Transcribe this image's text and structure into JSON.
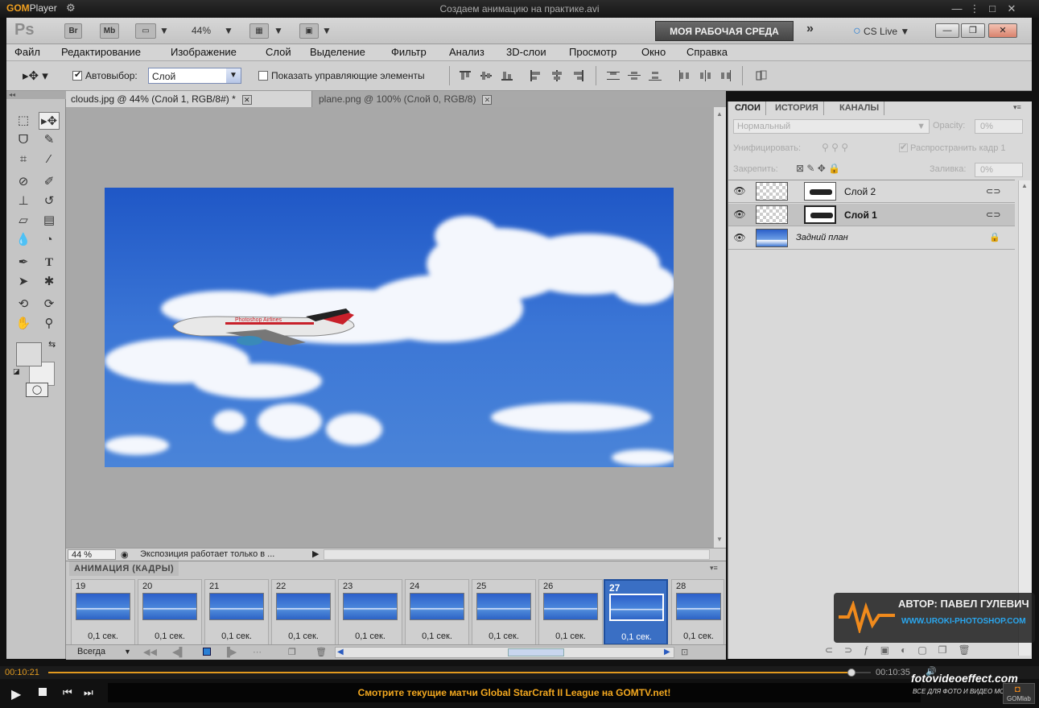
{
  "player": {
    "logo_gom": "GOM",
    "logo_player": "Player",
    "file_title": "Создаем анимацию на практике.avi",
    "time_current": "00:10:21",
    "time_total": "00:10:35",
    "seek_progress": 0.977,
    "ad_text": "Смотрите текущие матчи Global StarCraft II League на GOMTV.net!",
    "gomlab_label": "GOMlab"
  },
  "ps": {
    "logo": "Ps",
    "bridge_label": "Br",
    "minibridge_label": "Mb",
    "zoom_value": "44%",
    "workspace_button": "МОЯ РАБОЧАЯ СРЕДА",
    "cs_live": "CS Live"
  },
  "menu": [
    "Файл",
    "Редактирование",
    "Изображение",
    "Слой",
    "Выделение",
    "Фильтр",
    "Анализ",
    "3D-слои",
    "Просмотр",
    "Окно",
    "Справка"
  ],
  "options": {
    "autoselect_label": "Автовыбор:",
    "autoselect_checked": true,
    "autoselect_value": "Слой",
    "show_controls_label": "Показать управляющие элементы"
  },
  "document_tabs": [
    {
      "title": "clouds.jpg @ 44% (Слой 1, RGB/8#) *",
      "active": true
    },
    {
      "title": "plane.png @ 100% (Слой 0, RGB/8)",
      "active": false
    }
  ],
  "status": {
    "zoom": "44 %",
    "message": "Экспозиция работает только в ..."
  },
  "animation": {
    "panel_title": "АНИМАЦИЯ (КАДРЫ)",
    "loop_value": "Всегда",
    "frames": [
      {
        "number": "19",
        "delay": "0,1 сек."
      },
      {
        "number": "20",
        "delay": "0,1 сек."
      },
      {
        "number": "21",
        "delay": "0,1 сек."
      },
      {
        "number": "22",
        "delay": "0,1 сек."
      },
      {
        "number": "23",
        "delay": "0,1 сек."
      },
      {
        "number": "24",
        "delay": "0,1 сек."
      },
      {
        "number": "25",
        "delay": "0,1 сек."
      },
      {
        "number": "26",
        "delay": "0,1 сек."
      },
      {
        "number": "27",
        "delay": "0,1 сек."
      },
      {
        "number": "28",
        "delay": "0,1 сек."
      }
    ],
    "selected_frame": "27"
  },
  "layers_panel": {
    "tabs": [
      "СЛОИ",
      "ИСТОРИЯ",
      "КАНАЛЫ"
    ],
    "blend_mode": "Нормальный",
    "opacity_label": "Opacity:",
    "opacity_value": "0%",
    "unify_label": "Унифицировать:",
    "propagate_label": "Распространить кадр 1",
    "lock_label": "Закрепить:",
    "fill_label": "Заливка:",
    "fill_value": "0%",
    "layers": [
      {
        "name": "Слой 2",
        "selected": false
      },
      {
        "name": "Слой 1",
        "selected": true
      },
      {
        "name": "Задний план",
        "selected": false
      }
    ]
  },
  "watermark": {
    "author": "АВТОР: ПАВЕЛ ГУЛЕВИЧ",
    "site": "WWW.UROKI-PHOTOSHOP.COM",
    "brand": "fotovideoeffect.com",
    "tagline": "ВСЕ ДЛЯ ФОТО И ВИДЕО МОНТАЖА!"
  },
  "plane_livery": "Photoshop Airlines",
  "colors": {
    "accent_orange": "#f3a81f",
    "sky_blue": "#2f66d0",
    "selected_frame": "#3a6fc4"
  }
}
